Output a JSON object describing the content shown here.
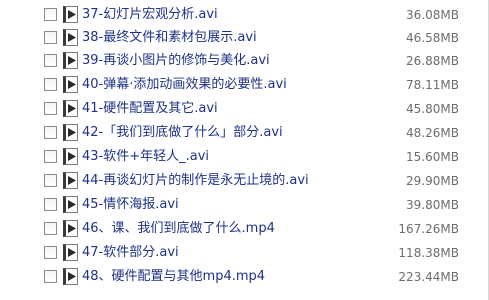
{
  "files": [
    {
      "name": "37-幻灯片宏观分析.avi",
      "size": "36.08MB",
      "icon": "video-file-icon"
    },
    {
      "name": "38-最终文件和素材包展示.avi",
      "size": "46.58MB",
      "icon": "video-file-icon"
    },
    {
      "name": "39-再谈小图片的修饰与美化.avi",
      "size": "26.88MB",
      "icon": "video-file-icon"
    },
    {
      "name": "40-弹幕·添加动画效果的必要性.avi",
      "size": "78.11MB",
      "icon": "video-file-icon"
    },
    {
      "name": "41-硬件配置及其它.avi",
      "size": "45.80MB",
      "icon": "video-file-icon"
    },
    {
      "name": "42-「我们到底做了什么」部分.avi",
      "size": "48.26MB",
      "icon": "video-file-icon"
    },
    {
      "name": "43-软件+年轻人_.avi",
      "size": "15.60MB",
      "icon": "video-file-icon"
    },
    {
      "name": "44-再谈幻灯片的制作是永无止境的.avi",
      "size": "29.90MB",
      "icon": "video-file-icon"
    },
    {
      "name": "45-情怀海报.avi",
      "size": "39.80MB",
      "icon": "video-file-icon"
    },
    {
      "name": "46、课、我们到底做了什么.mp4",
      "size": "167.26MB",
      "icon": "video-file-icon"
    },
    {
      "name": "47-软件部分.avi",
      "size": "118.38MB",
      "icon": "video-file-icon"
    },
    {
      "name": "48、硬件配置与其他mp4.mp4",
      "size": "223.44MB",
      "icon": "video-file-icon"
    }
  ]
}
